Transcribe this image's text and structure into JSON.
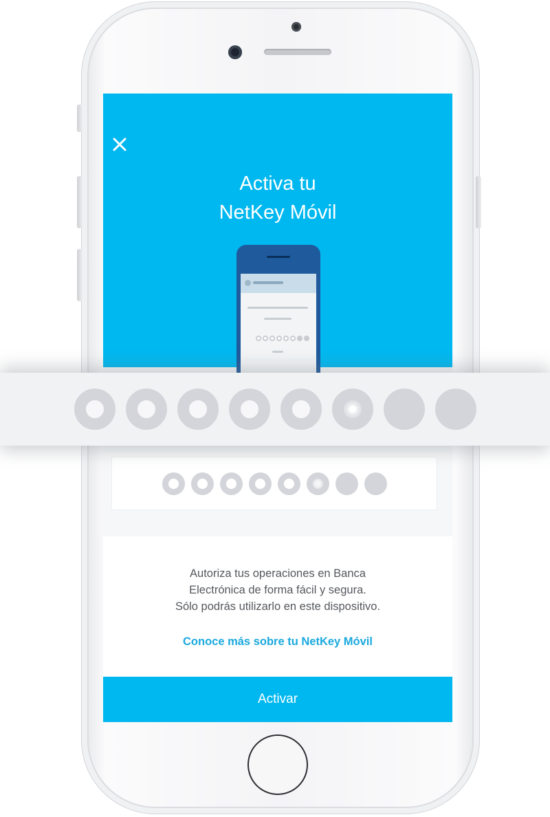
{
  "header": {
    "close_icon": "close-icon",
    "title_line1": "Activa tu",
    "title_line2": "NetKey Móvil"
  },
  "pin_indicator": {
    "total": 8,
    "states": [
      "empty",
      "empty",
      "empty",
      "empty",
      "empty",
      "active",
      "filled",
      "filled"
    ]
  },
  "description": {
    "line1": "Autoriza tus operaciones en Banca",
    "line2": "Electrónica de forma fácil y segura.",
    "line3": "Sólo podrás utilizarlo en este dispositivo."
  },
  "learn_more_link": "Conoce más sobre tu NetKey Móvil",
  "activate_button": "Activar",
  "colors": {
    "brand": "#00b8f0",
    "link": "#1aa9dd",
    "text": "#55585d",
    "dot": "#d4d5da"
  }
}
